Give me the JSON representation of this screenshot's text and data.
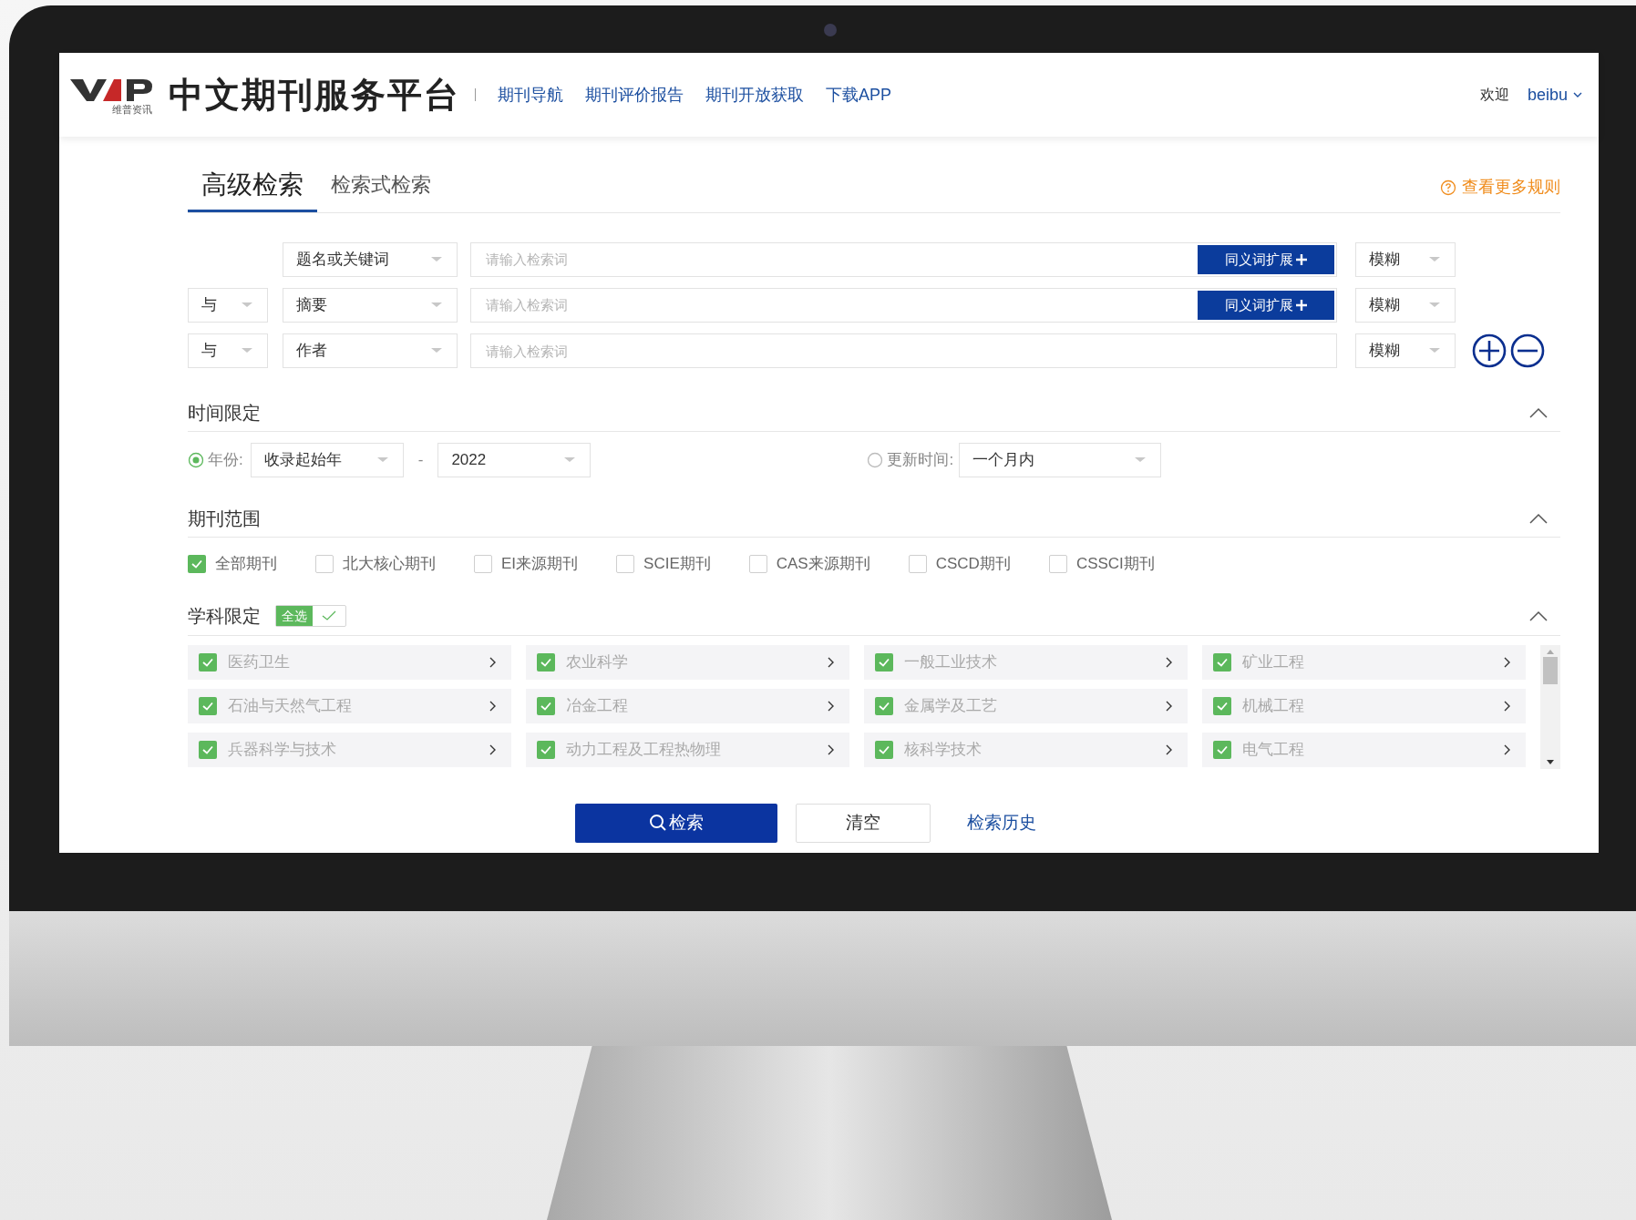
{
  "header": {
    "logo_text": "中文期刊服务平台",
    "logo_sub": "维普资讯",
    "nav": [
      "期刊导航",
      "期刊评价报告",
      "期刊开放获取",
      "下载APP"
    ],
    "welcome": "欢迎",
    "user": "beibu"
  },
  "tabs": [
    {
      "label": "高级检索",
      "selected": true
    },
    {
      "label": "检索式检索",
      "selected": false
    }
  ],
  "rules_link": "查看更多规则",
  "search_rows": [
    {
      "logic": null,
      "field": "题名或关键词",
      "placeholder": "请输入检索词",
      "synonym": "同义词扩展",
      "match": "模糊"
    },
    {
      "logic": "与",
      "field": "摘要",
      "placeholder": "请输入检索词",
      "synonym": "同义词扩展",
      "match": "模糊"
    },
    {
      "logic": "与",
      "field": "作者",
      "placeholder": "请输入检索词",
      "synonym": null,
      "match": "模糊"
    }
  ],
  "time_section": {
    "title": "时间限定",
    "expanded": true,
    "year_label": "年份:",
    "year_selected": true,
    "year_from": "收录起始年",
    "dash": "-",
    "year_to": "2022",
    "update_label": "更新时间:",
    "update_selected": false,
    "update_value": "一个月内"
  },
  "journal_section": {
    "title": "期刊范围",
    "expanded": true,
    "options": [
      {
        "label": "全部期刊",
        "checked": true
      },
      {
        "label": "北大核心期刊",
        "checked": false
      },
      {
        "label": "EI来源期刊",
        "checked": false
      },
      {
        "label": "SCIE期刊",
        "checked": false
      },
      {
        "label": "CAS来源期刊",
        "checked": false
      },
      {
        "label": "CSCD期刊",
        "checked": false
      },
      {
        "label": "CSSCI期刊",
        "checked": false
      }
    ]
  },
  "subject_section": {
    "title": "学科限定",
    "select_all": "全选",
    "select_all_checked": true,
    "expanded": true,
    "subjects": [
      {
        "label": "医药卫生",
        "checked": true
      },
      {
        "label": "农业科学",
        "checked": true
      },
      {
        "label": "一般工业技术",
        "checked": true
      },
      {
        "label": "矿业工程",
        "checked": true
      },
      {
        "label": "石油与天然气工程",
        "checked": true
      },
      {
        "label": "冶金工程",
        "checked": true
      },
      {
        "label": "金属学及工艺",
        "checked": true
      },
      {
        "label": "机械工程",
        "checked": true
      },
      {
        "label": "兵器科学与技术",
        "checked": true
      },
      {
        "label": "动力工程及工程热物理",
        "checked": true
      },
      {
        "label": "核科学技术",
        "checked": true
      },
      {
        "label": "电气工程",
        "checked": true
      }
    ]
  },
  "actions": {
    "search": "检索",
    "clear": "清空",
    "history": "检索历史"
  }
}
